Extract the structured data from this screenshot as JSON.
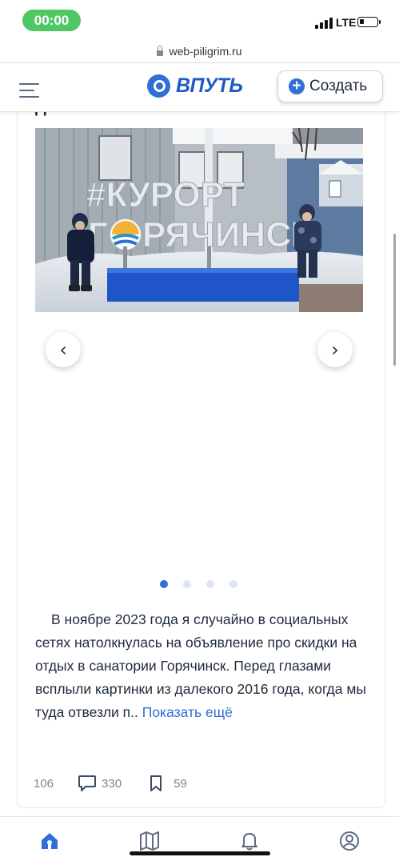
{
  "status_bar": {
    "time": "00:00",
    "network": "LTE"
  },
  "browser": {
    "url": "web-piligrim.ru"
  },
  "header": {
    "logo_text": "ВПУТЬ",
    "create_label": "Создать"
  },
  "post": {
    "title_fragment": "детьми",
    "photo": {
      "sign_top": "#КУРОРТ",
      "sign_bottom_left": "Г",
      "sign_bottom_right": "РЯЧИНСК"
    },
    "carousel": {
      "slides": 4,
      "active": 1
    },
    "text": "В ноябре 2023 года я случайно в социальных сетях натолкнулась на объявление про скидки на отдых в санатории Горячинск. Перед глазами всплыли картинки из далекого 2016 года, когда мы туда отвезли п..",
    "more_label": "Показать ещё",
    "stats": {
      "likes": "106",
      "comments": "330",
      "saves": "59"
    }
  },
  "colors": {
    "accent": "#2f6fd6",
    "time_pill": "#4fc764",
    "text": "#1e2a3a"
  },
  "icons": {
    "nav": [
      "menu-icon",
      "home-icon",
      "map-icon",
      "bell-icon",
      "profile-icon"
    ],
    "stats": [
      "comment-icon",
      "bookmark-icon"
    ]
  }
}
